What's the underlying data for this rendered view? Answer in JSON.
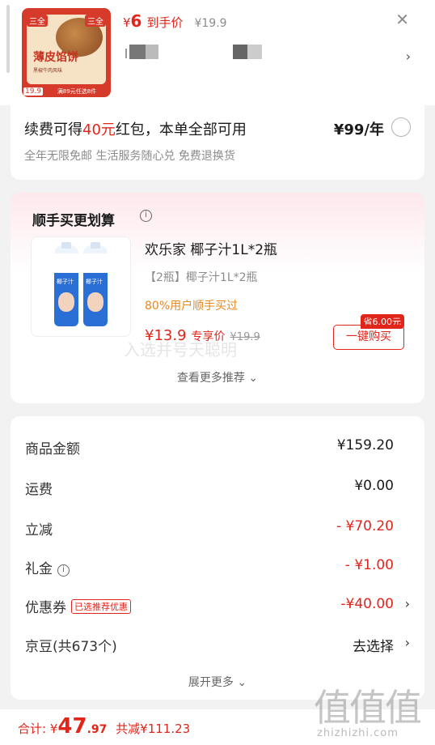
{
  "header": {
    "deal_price_symbol": "¥",
    "deal_price": "6",
    "deal_price_label": "到手价",
    "original_price": "¥19.9",
    "product_image": {
      "brand": "三全",
      "name": "薄皮馅饼",
      "subtitle": "黑椒牛肉风味",
      "price": "19.9",
      "promo": "满89元任选8件"
    }
  },
  "membership": {
    "text_prefix": "续费可得",
    "highlight": "40元",
    "text_suffix": "红包，本单全部可用",
    "price": "¥99/年",
    "benefits": "全年无限免邮 生活服务随心兑 免费退换货"
  },
  "addon": {
    "title": "顺手买更划算",
    "product_name": "欢乐家 椰子汁1L*2瓶",
    "spec": "【2瓶】椰子汁1L*2瓶",
    "users": "80%用户顺手买过",
    "price": "¥13.9",
    "price_label": "专享价",
    "orig_price": "¥19.9",
    "save_badge": "省6.00元",
    "buy_button": "一键购买",
    "watermark": "入选并号天聪明",
    "more": "查看更多推荐",
    "bottle_label": "椰子汁"
  },
  "summary": {
    "rows": [
      {
        "label": "商品金额",
        "value": "¥159.20"
      },
      {
        "label": "运费",
        "value": "¥0.00"
      },
      {
        "label": "立减",
        "value": "- ¥70.20"
      },
      {
        "label": "礼金",
        "value": "- ¥1.00"
      },
      {
        "label": "优惠券",
        "badge": "已选推荐优惠",
        "value": "-¥40.00"
      },
      {
        "label": "京豆(共673个)",
        "value": "去选择"
      }
    ],
    "expand": "展开更多"
  },
  "footer": {
    "total_label": "合计:",
    "total_symbol": "¥",
    "total_int": "47",
    "total_dec": ".97",
    "saved": "共减¥111.23"
  },
  "watermark_logo": {
    "glyphs": "值值值",
    "site": "zhizhizhi.com"
  },
  "colors": {
    "accent": "#e1251b",
    "orange": "#e8871e",
    "muted": "#8c8c8c"
  }
}
